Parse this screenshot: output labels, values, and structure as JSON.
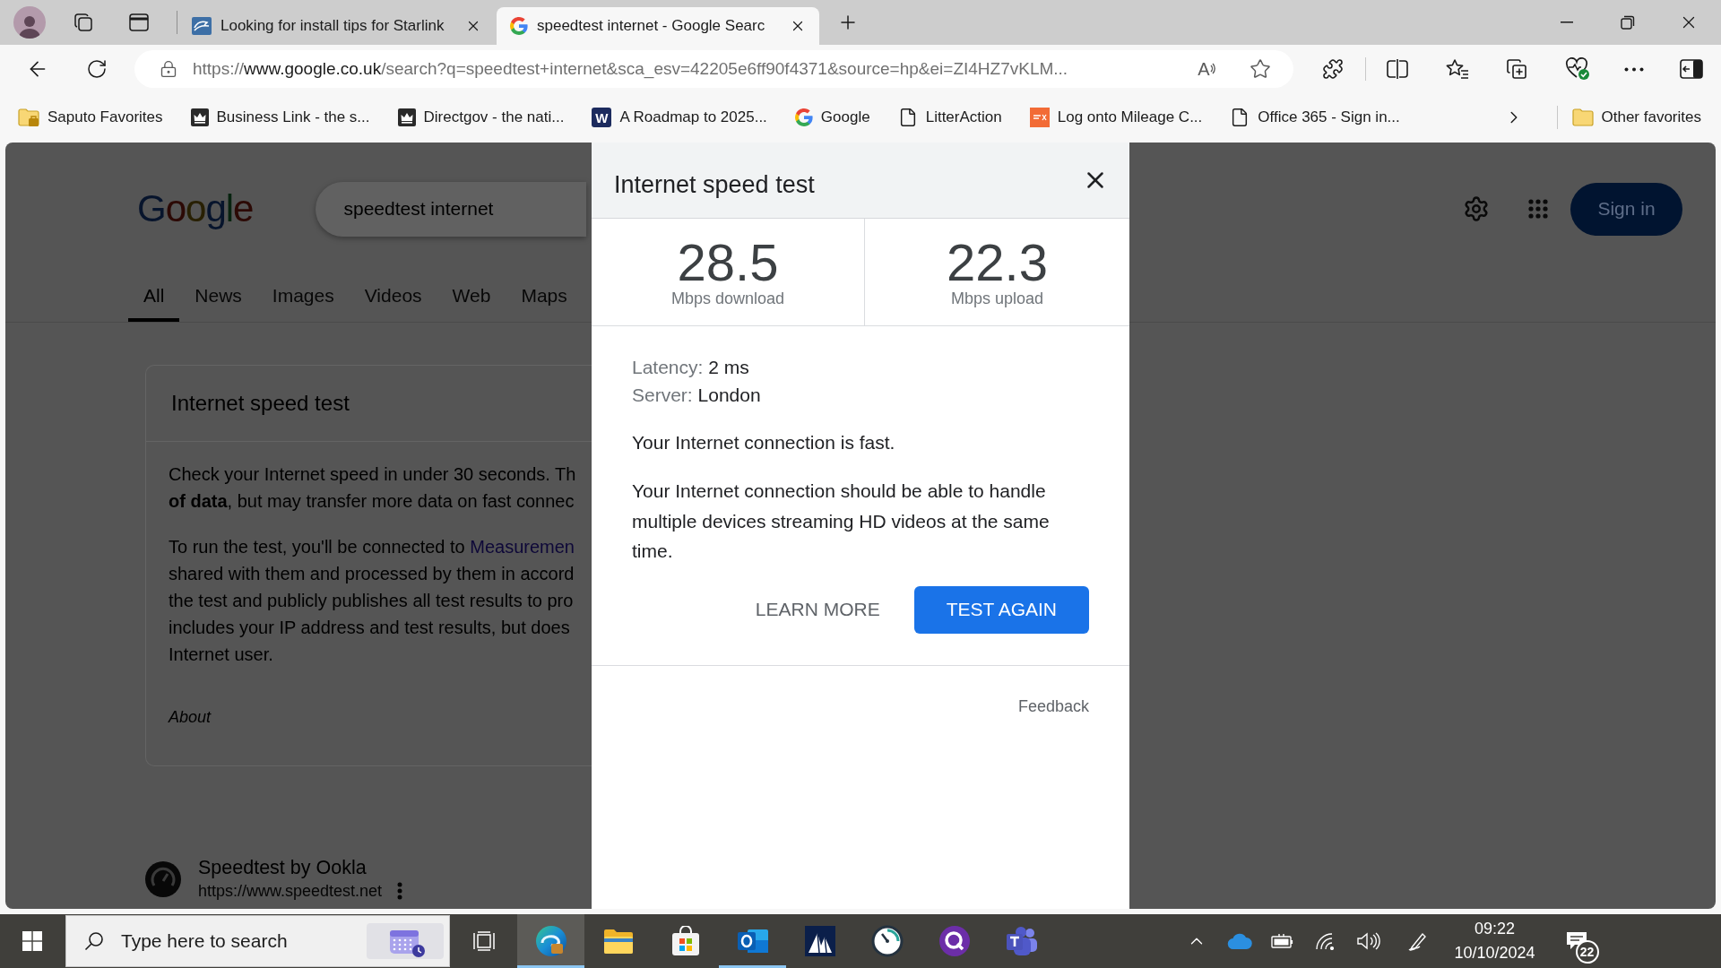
{
  "browser": {
    "tabs": [
      {
        "kind": "site",
        "title": "Looking for install tips for Starlink",
        "selected": false
      },
      {
        "kind": "google",
        "title": "speedtest internet - Google Searc",
        "selected": true
      }
    ],
    "address_bar": {
      "scheme": "https://",
      "host": "www.google.co.uk",
      "path": "/search?q=speedtest+internet&sca_esv=42205e6ff90f4371&source=hp&ei=ZI4HZ7vKLM...",
      "read_aloud": "A"
    },
    "favorites": [
      {
        "kind": "folder",
        "label": "Saputo Favorites"
      },
      {
        "kind": "crown",
        "label": "Business Link - the s..."
      },
      {
        "kind": "crown",
        "label": "Directgov - the nati..."
      },
      {
        "kind": "letter",
        "badge_text": "W",
        "label": "A Roadmap to 2025..."
      },
      {
        "kind": "google",
        "label": "Google"
      },
      {
        "kind": "page",
        "label": "LitterAction"
      },
      {
        "kind": "orange-tile",
        "label": "Log onto Mileage C..."
      },
      {
        "kind": "page",
        "label": "Office 365 - Sign in..."
      }
    ],
    "other_favorites": "Other favorites"
  },
  "search_page": {
    "logo": "Google",
    "query": "speedtest internet",
    "sign_in": "Sign in",
    "tabs": [
      {
        "label": "All",
        "selected": true
      },
      {
        "label": "News",
        "selected": false
      },
      {
        "label": "Images",
        "selected": false
      },
      {
        "label": "Videos",
        "selected": false
      },
      {
        "label": "Web",
        "selected": false
      },
      {
        "label": "Maps",
        "selected": false
      }
    ],
    "card": {
      "title": "Internet speed test",
      "paragraphs": [
        {
          "lines": [
            {
              "text": "Check your Internet speed in under 30 seconds. Th"
            },
            {
              "text": "**of data**, but may transfer more data on fast connec"
            }
          ]
        },
        {
          "lines": [
            {
              "text": "To run the test, you'll be connected to ",
              "link": "Measuremen"
            },
            {
              "text": "shared with them and processed by them in accord"
            },
            {
              "text": "the test and publicly publishes all test results to pro"
            },
            {
              "text": "includes your IP address and test results, but does"
            },
            {
              "text": "Internet user."
            }
          ]
        }
      ],
      "about": "About"
    },
    "result": {
      "title": "Speedtest by Ookla",
      "url": "https://www.speedtest.net"
    }
  },
  "dialog": {
    "title": "Internet speed test",
    "metrics": [
      {
        "value": "28.5",
        "label": "Mbps download"
      },
      {
        "value": "22.3",
        "label": "Mbps upload"
      }
    ],
    "details": [
      {
        "label": "Latency:",
        "value": "2 ms"
      },
      {
        "label": "Server:",
        "value": "London"
      }
    ],
    "verdict": "Your Internet connection is fast.",
    "description": "Your Internet connection should be able to handle multiple devices streaming HD videos at the same time.",
    "buttons": [
      {
        "kind": "text",
        "label": "LEARN MORE"
      },
      {
        "kind": "primary",
        "label": "TEST AGAIN"
      }
    ],
    "feedback": "Feedback"
  },
  "taskbar": {
    "search_placeholder": "Type here to search",
    "apps": [
      {
        "kind": "task-view",
        "active": false,
        "running": false
      },
      {
        "kind": "edge",
        "active": true,
        "running": true
      },
      {
        "kind": "explorer",
        "active": false,
        "running": false
      },
      {
        "kind": "store",
        "active": false,
        "running": false
      },
      {
        "kind": "outlook",
        "active": false,
        "running": true
      },
      {
        "kind": "dynamics",
        "active": false,
        "running": false
      },
      {
        "kind": "clock",
        "active": false,
        "running": false
      },
      {
        "kind": "q",
        "active": false,
        "running": false
      },
      {
        "kind": "teams",
        "active": false,
        "running": false
      }
    ],
    "time": "09:22",
    "date": "10/10/2024",
    "notification_count": "22"
  }
}
